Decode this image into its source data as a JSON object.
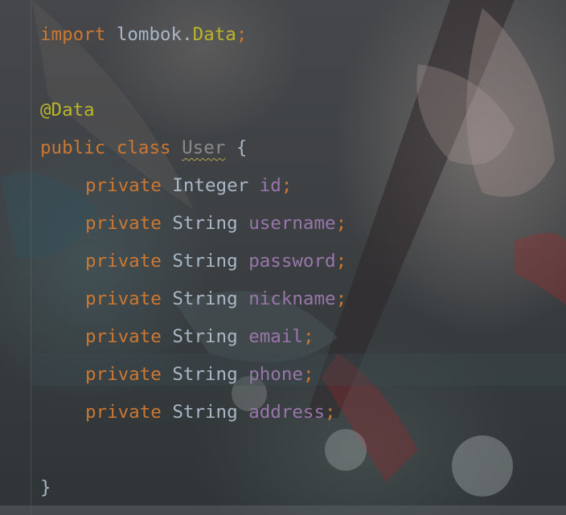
{
  "editor": {
    "language": "Java",
    "lines": [
      {
        "tokens": [
          {
            "t": "import",
            "k": "kw"
          },
          {
            "t": " ",
            "k": "plain"
          },
          {
            "t": "lombok.",
            "k": "pkg"
          },
          {
            "t": "Data",
            "k": "ann"
          },
          {
            "t": ";",
            "k": "sem"
          }
        ]
      },
      {
        "tokens": []
      },
      {
        "tokens": [
          {
            "t": "@Data",
            "k": "ann"
          }
        ]
      },
      {
        "tokens": [
          {
            "t": "public",
            "k": "kw"
          },
          {
            "t": " ",
            "k": "plain"
          },
          {
            "t": "class",
            "k": "kw"
          },
          {
            "t": " ",
            "k": "plain"
          },
          {
            "t": "User",
            "k": "cls-unused"
          },
          {
            "t": " {",
            "k": "plain"
          }
        ]
      },
      {
        "indent": 1,
        "tokens": [
          {
            "t": "private",
            "k": "kw"
          },
          {
            "t": " ",
            "k": "plain"
          },
          {
            "t": "Integer",
            "k": "type"
          },
          {
            "t": " ",
            "k": "plain"
          },
          {
            "t": "id",
            "k": "field"
          },
          {
            "t": ";",
            "k": "sem"
          }
        ]
      },
      {
        "indent": 1,
        "tokens": [
          {
            "t": "private",
            "k": "kw"
          },
          {
            "t": " ",
            "k": "plain"
          },
          {
            "t": "String",
            "k": "type"
          },
          {
            "t": " ",
            "k": "plain"
          },
          {
            "t": "username",
            "k": "field"
          },
          {
            "t": ";",
            "k": "sem"
          }
        ]
      },
      {
        "indent": 1,
        "tokens": [
          {
            "t": "private",
            "k": "kw"
          },
          {
            "t": " ",
            "k": "plain"
          },
          {
            "t": "String",
            "k": "type"
          },
          {
            "t": " ",
            "k": "plain"
          },
          {
            "t": "password",
            "k": "field"
          },
          {
            "t": ";",
            "k": "sem"
          }
        ]
      },
      {
        "indent": 1,
        "tokens": [
          {
            "t": "private",
            "k": "kw"
          },
          {
            "t": " ",
            "k": "plain"
          },
          {
            "t": "String",
            "k": "type"
          },
          {
            "t": " ",
            "k": "plain"
          },
          {
            "t": "nickname",
            "k": "field"
          },
          {
            "t": ";",
            "k": "sem"
          }
        ]
      },
      {
        "indent": 1,
        "tokens": [
          {
            "t": "private",
            "k": "kw"
          },
          {
            "t": " ",
            "k": "plain"
          },
          {
            "t": "String",
            "k": "type"
          },
          {
            "t": " ",
            "k": "plain"
          },
          {
            "t": "email",
            "k": "field"
          },
          {
            "t": ";",
            "k": "sem"
          }
        ]
      },
      {
        "indent": 1,
        "tokens": [
          {
            "t": "private",
            "k": "kw"
          },
          {
            "t": " ",
            "k": "plain"
          },
          {
            "t": "String",
            "k": "type"
          },
          {
            "t": " ",
            "k": "plain"
          },
          {
            "t": "phone",
            "k": "field"
          },
          {
            "t": ";",
            "k": "sem"
          }
        ]
      },
      {
        "indent": 1,
        "tokens": [
          {
            "t": "private",
            "k": "kw"
          },
          {
            "t": " ",
            "k": "plain"
          },
          {
            "t": "String",
            "k": "type"
          },
          {
            "t": " ",
            "k": "plain"
          },
          {
            "t": "address",
            "k": "field"
          },
          {
            "t": ";",
            "k": "sem"
          }
        ]
      },
      {
        "tokens": []
      },
      {
        "tokens": [
          {
            "t": "}",
            "k": "plain"
          }
        ]
      }
    ]
  },
  "colors": {
    "keyword": "#cc7832",
    "annotation": "#bbb529",
    "field": "#9876aa",
    "default": "#a9b7c6"
  }
}
